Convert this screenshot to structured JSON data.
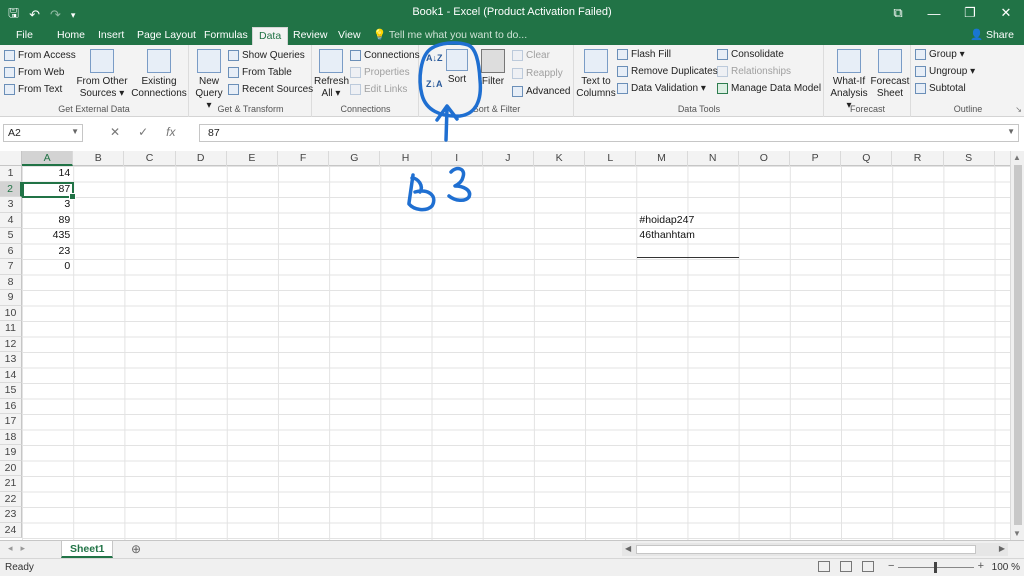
{
  "titlebar": {
    "title": "Book1 - Excel (Product Activation Failed)",
    "qat": {
      "save": "save-icon",
      "undo": "undo-icon",
      "redo": "redo-icon",
      "customize": "customize-icon"
    }
  },
  "tabs": [
    {
      "label": "File"
    },
    {
      "label": "Home"
    },
    {
      "label": "Insert"
    },
    {
      "label": "Page Layout"
    },
    {
      "label": "Formulas"
    },
    {
      "label": "Data"
    },
    {
      "label": "Review"
    },
    {
      "label": "View"
    }
  ],
  "tellme": "Tell me what you want to do...",
  "share": "Share",
  "ribbon": {
    "get_external": {
      "from_access": "From Access",
      "from_web": "From Web",
      "from_text": "From Text",
      "from_other": "From Other",
      "sources": "Sources ▾",
      "existing": "Existing",
      "connections": "Connections",
      "label": "Get External Data"
    },
    "get_transform": {
      "new": "New",
      "query": "Query ▾",
      "show_queries": "Show Queries",
      "from_table": "From Table",
      "recent_sources": "Recent Sources",
      "label": "Get & Transform"
    },
    "connections": {
      "refresh": "Refresh",
      "all": "All ▾",
      "connections": "Connections",
      "properties": "Properties",
      "edit_links": "Edit Links",
      "label": "Connections"
    },
    "sort_filter": {
      "sort": "Sort",
      "filter": "Filter",
      "clear": "Clear",
      "reapply": "Reapply",
      "advanced": "Advanced",
      "label": "Sort & Filter"
    },
    "data_tools": {
      "text_to": "Text to",
      "columns": "Columns",
      "flash_fill": "Flash Fill",
      "remove_duplicates": "Remove Duplicates",
      "data_validation": "Data Validation ▾",
      "consolidate": "Consolidate",
      "relationships": "Relationships",
      "manage_data_model": "Manage Data Model",
      "label": "Data Tools"
    },
    "forecast": {
      "what_if": "What-If",
      "analysis": "Analysis ▾",
      "forecast": "Forecast",
      "sheet": "Sheet",
      "label": "Forecast"
    },
    "outline": {
      "group": "Group ▾",
      "ungroup": "Ungroup ▾",
      "subtotal": "Subtotal",
      "label": "Outline"
    }
  },
  "formula_bar": {
    "name_box": "A2",
    "cancel": "✕",
    "enter": "✓",
    "fx": "fx",
    "value": "87"
  },
  "columns": [
    "A",
    "B",
    "C",
    "D",
    "E",
    "F",
    "G",
    "H",
    "I",
    "J",
    "K",
    "L",
    "M",
    "N",
    "O",
    "P",
    "Q",
    "R",
    "S"
  ],
  "rows": [
    "1",
    "2",
    "3",
    "4",
    "5",
    "6",
    "7",
    "8",
    "9",
    "10",
    "11",
    "12",
    "13",
    "14",
    "15",
    "16",
    "17",
    "18",
    "19",
    "20",
    "21",
    "22",
    "23",
    "24"
  ],
  "cells": {
    "A1": "14",
    "A2": "87",
    "A3": "3",
    "A4": "89",
    "A5": "435",
    "A6": "23",
    "A7": "0",
    "M4": "#hoidap247",
    "M5": "46thanhtam"
  },
  "sheet_tab": "Sheet1",
  "status": {
    "ready": "Ready",
    "zoom": "100 %"
  },
  "colors": {
    "accent": "#217346",
    "annotation": "#1f6fd1"
  }
}
